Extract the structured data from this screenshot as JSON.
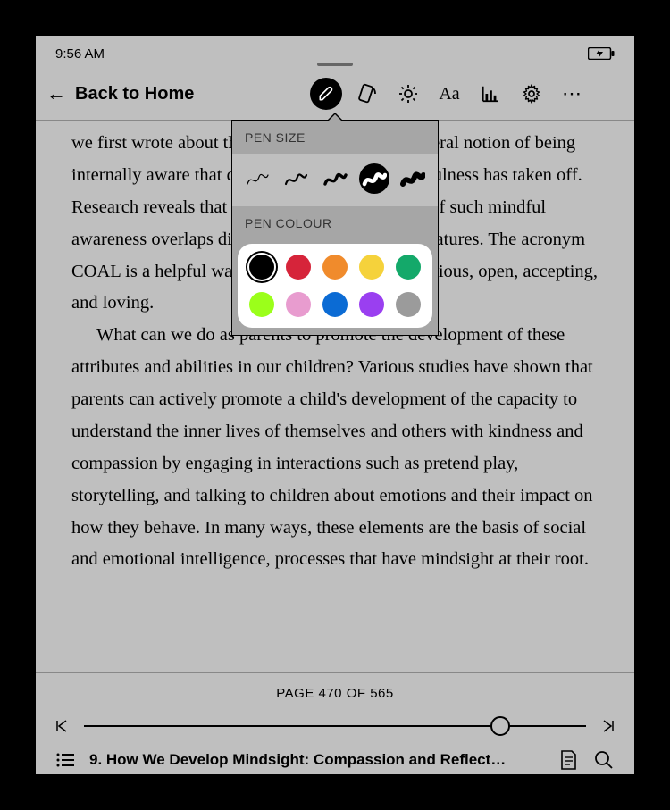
{
  "status": {
    "time": "9:56 AM"
  },
  "nav": {
    "back_label": "Back to Home"
  },
  "popover": {
    "size_label": "PEN SIZE",
    "colour_label": "PEN COLOUR",
    "sizes": [
      {
        "w": 1.2,
        "selected": false
      },
      {
        "w": 2.2,
        "selected": false
      },
      {
        "w": 3.4,
        "selected": false
      },
      {
        "w": 4.6,
        "selected": true
      },
      {
        "w": 6.0,
        "selected": false
      }
    ],
    "colours": [
      {
        "hex": "#000000",
        "selected": true
      },
      {
        "hex": "#d6243a",
        "selected": false
      },
      {
        "hex": "#f08b2c",
        "selected": false
      },
      {
        "hex": "#f5d23b",
        "selected": false
      },
      {
        "hex": "#14a96a",
        "selected": false
      },
      {
        "hex": "#9bff1a",
        "selected": false
      },
      {
        "hex": "#e89ccf",
        "selected": false
      },
      {
        "hex": "#0b6bd4",
        "selected": false
      },
      {
        "hex": "#9a3ff0",
        "selected": false
      },
      {
        "hex": "#9b9b9b",
        "selected": false
      }
    ]
  },
  "page": {
    "para1": "we first wrote about these topics in 2003, the general notion of being internally aware that defines the science of mindfulness has taken off. Research reveals that the presence and openness of such mindful awareness overlaps directly with these parental features. The acronym COAL is a helpful way to remember this idea: curious, open, accepting, and loving.",
    "para2": "What can we do as parents to promote the development of these attributes and abilities in our children? Various studies have shown that parents can actively promote a child's development of the capacity to understand the inner lives of themselves and others with kindness and compassion by engaging in interactions such as pretend play, storytelling, and talking to children about emotions and their impact on how they behave. In many ways, these elements are the basis of social and emotional intelligence, processes that have mindsight at their root."
  },
  "footer": {
    "page_label": "PAGE 470 OF 565",
    "progress_pct": 83,
    "chapter": "9. How We Develop Mindsight: Compassion and Reflect…"
  }
}
